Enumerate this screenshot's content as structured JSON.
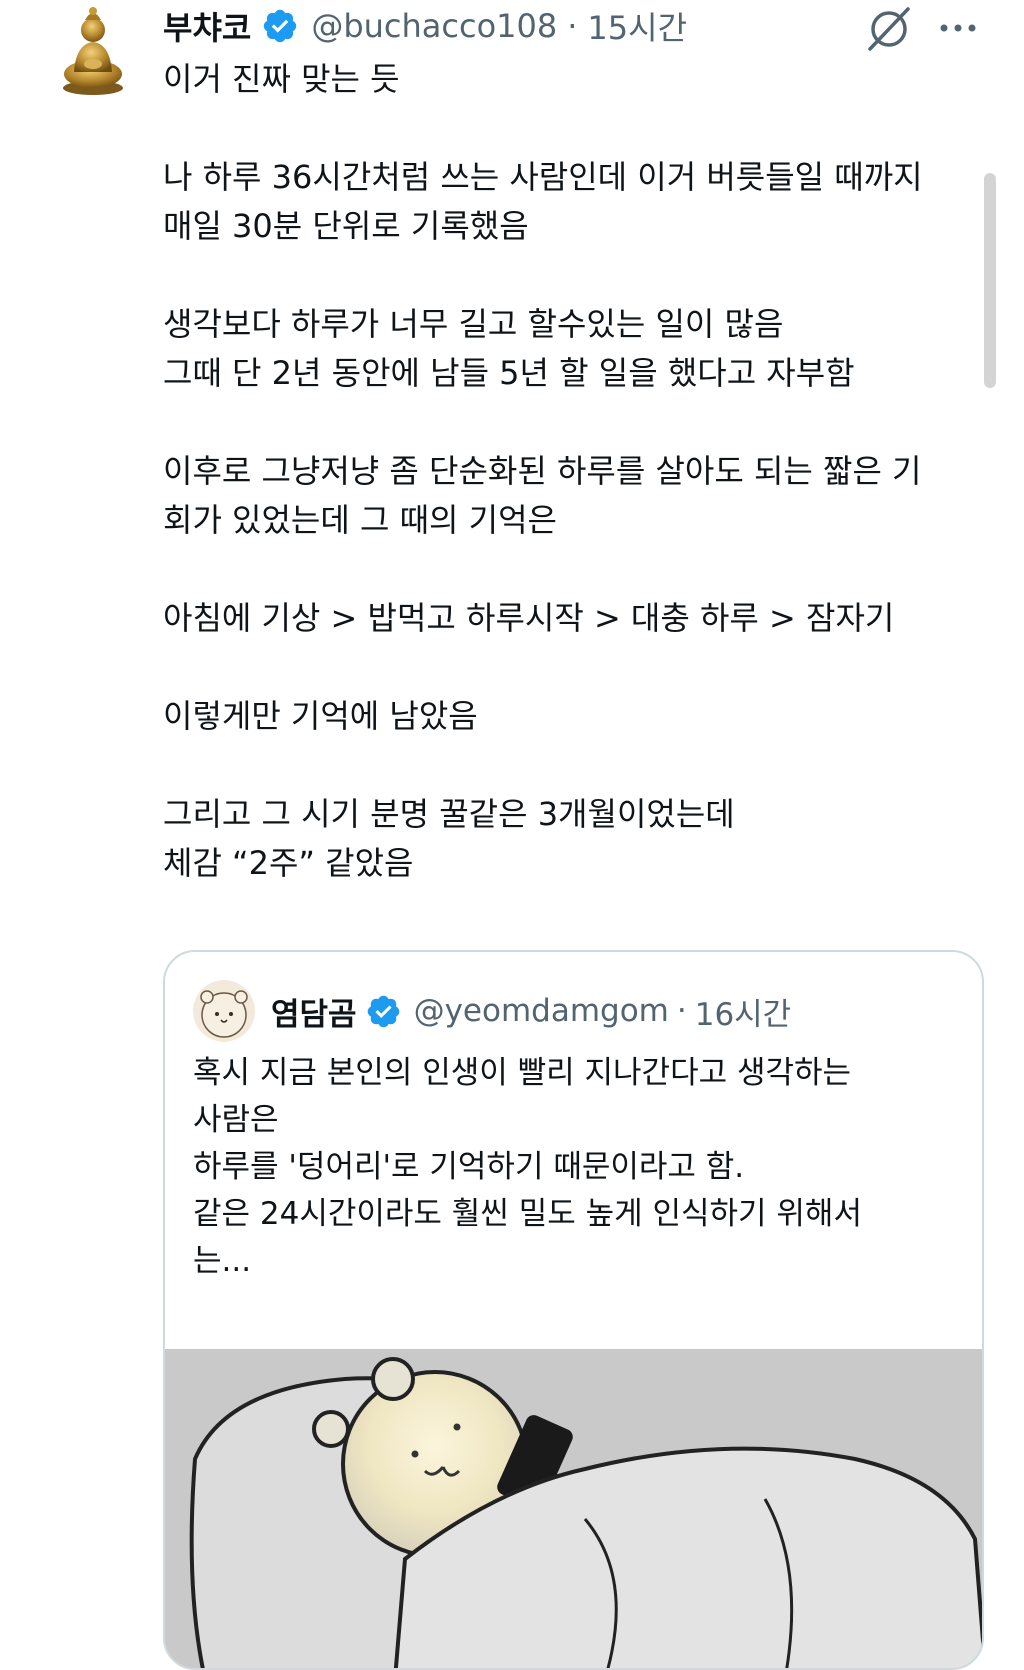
{
  "tweet": {
    "display_name": "부챠코",
    "handle": "@buchacco108",
    "dot": "·",
    "time": "15시간",
    "lines": [
      "이거 진짜 맞는 듯",
      "",
      "나 하루 36시간처럼 쓰는 사람인데 이거 버릇들일 때까지",
      "매일 30분 단위로 기록했음",
      "",
      "생각보다 하루가 너무 길고 할수있는 일이 많음",
      "그때 단 2년 동안에 남들 5년 할 일을 했다고 자부함",
      "",
      "이후로 그냥저냥 좀 단순화된 하루를 살아도 되는 짧은 기",
      "회가 있었는데 그 때의 기억은",
      "",
      "아침에 기상 > 밥먹고 하루시작 > 대충 하루 > 잠자기",
      "",
      "이렇게만 기억에 남았음",
      "",
      "그리고 그 시기 분명 꿀같은 3개월이었는데",
      "체감 “2주” 같았음"
    ]
  },
  "quote": {
    "display_name": "염담곰",
    "handle": "@yeomdamgom",
    "dot": "·",
    "time": "16시간",
    "lines": [
      "혹시 지금 본인의 인생이 빨리 지나간다고 생각하는",
      "사람은",
      "하루를 '덩어리'로 기억하기 때문이라고 함.",
      "같은 24시간이라도 훨씬 밀도 높게 인식하기 위해서",
      "는..."
    ]
  },
  "icons": {
    "verified": "verified-badge-icon",
    "grok": "grok-icon",
    "more": "more-options-icon"
  },
  "colors": {
    "verified_blue": "#1d9bf0",
    "secondary_text": "#536471",
    "border": "#cfd9de"
  }
}
